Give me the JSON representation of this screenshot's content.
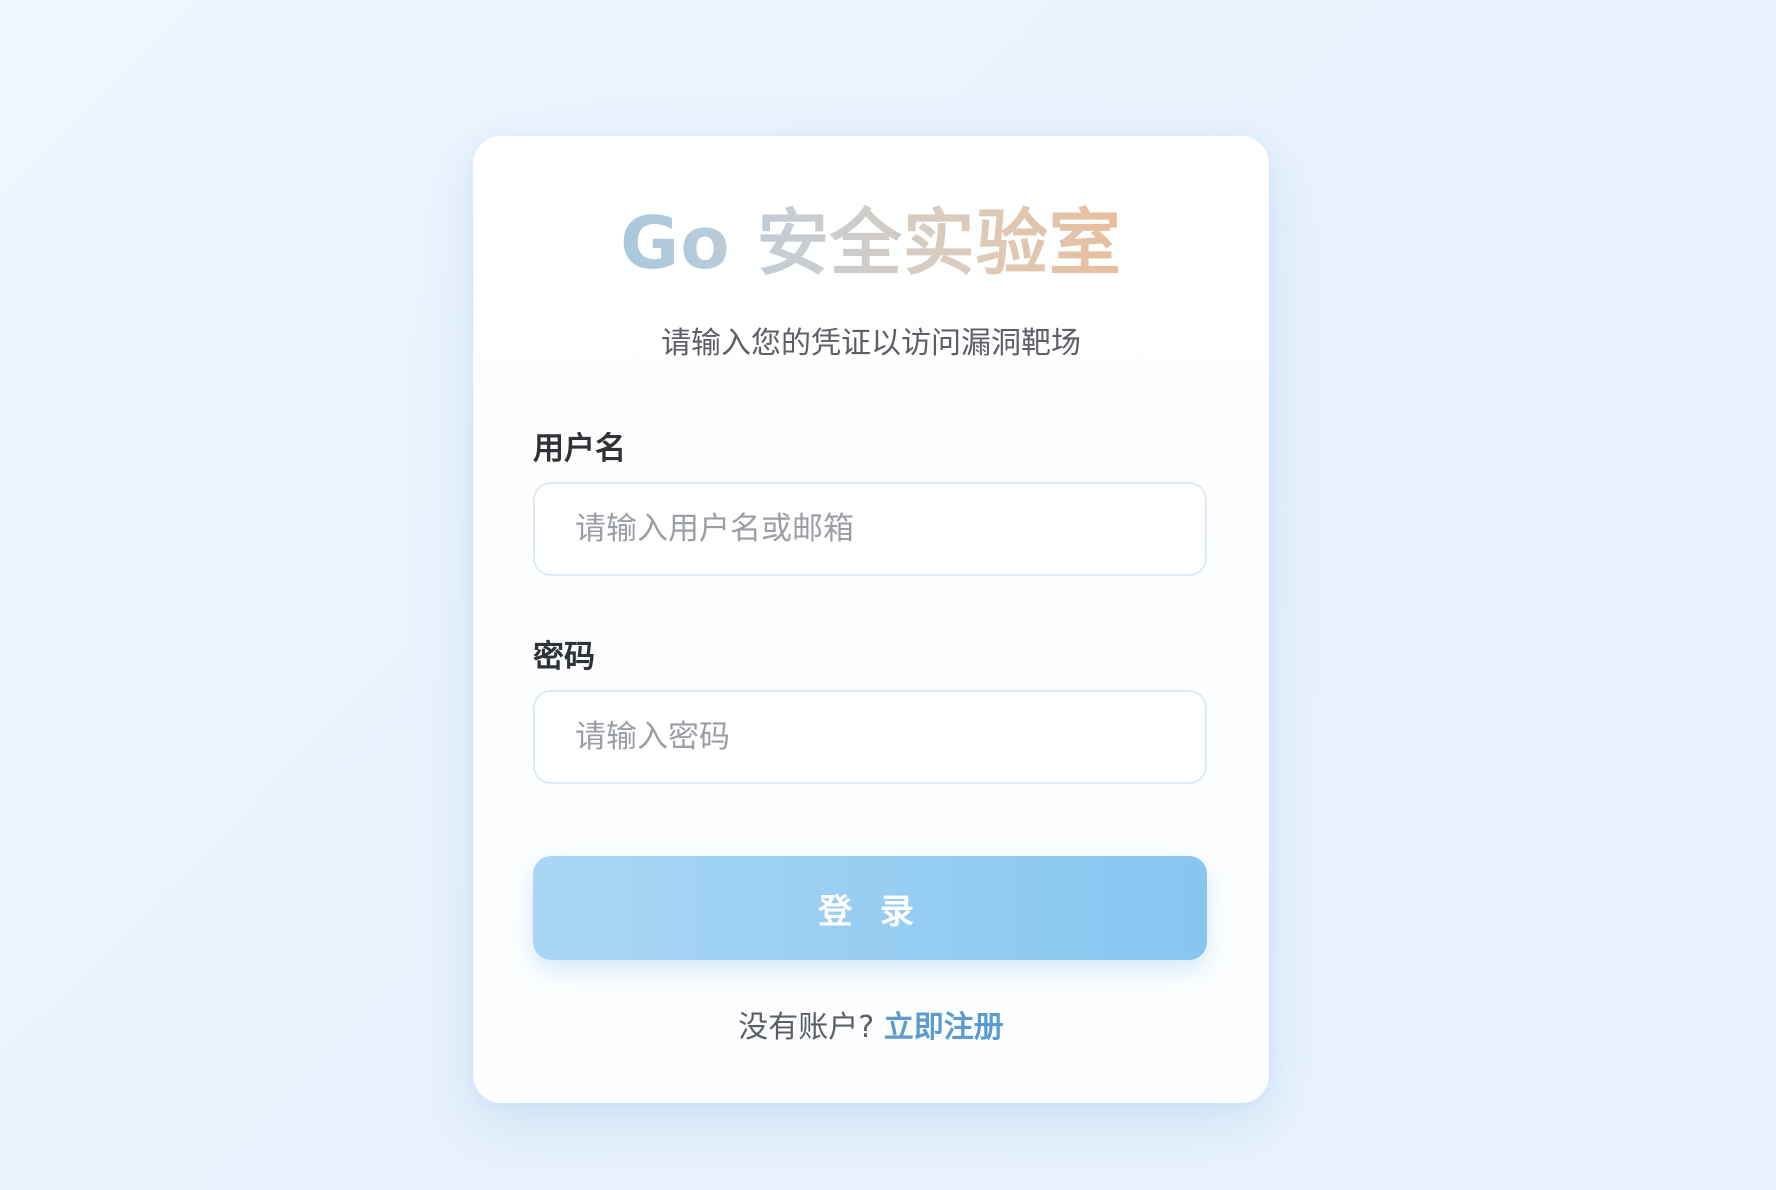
{
  "login": {
    "title": "Go 安全实验室",
    "subtitle": "请输入您的凭证以访问漏洞靶场",
    "username": {
      "label": "用户名",
      "placeholder": "请输入用户名或邮箱",
      "value": ""
    },
    "password": {
      "label": "密码",
      "placeholder": "请输入密码",
      "value": ""
    },
    "submit_label": "登 录",
    "footer": {
      "prompt": "没有账户? ",
      "register_link": "立即注册"
    }
  },
  "colors": {
    "background": "#eef6fe",
    "card": "#ffffff",
    "button_start": "#aad6f5",
    "button_end": "#86c6f0",
    "link": "#5a9bd0",
    "title_gradient": [
      "#a9c8de",
      "#c7cdd2",
      "#dccbbb",
      "#e9bd9b"
    ]
  }
}
